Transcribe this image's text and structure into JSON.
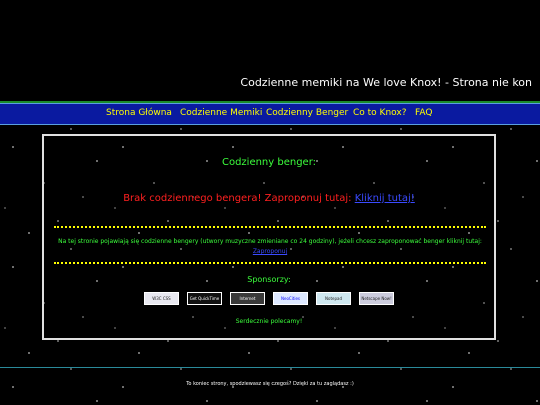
{
  "site": {
    "title": "Codzienne memiki na We love Knox! - Strona nie kon"
  },
  "nav": {
    "items": [
      {
        "label": "Strona Główna"
      },
      {
        "label": "Codzienne Memiki"
      },
      {
        "label": "Codzienny Benger"
      },
      {
        "label": "Co to Knox?"
      },
      {
        "label": "FAQ"
      }
    ]
  },
  "main": {
    "heading": "Codzienny benger:",
    "no_benger_text": "Brak codziennego bengera! Zaproponuj tutaj: ",
    "no_benger_link": "Kliknij tutaj!",
    "info_text": "Na tej stronie pojawiają się codzienne bengery (utwory muzyczne zmieniane co 24 godziny), jeżeli chcesz zaproponować benger kliknij tutaj: ",
    "info_link": "Zaproponuj",
    "sponsors_label": "Sponsorzy:",
    "badges": [
      {
        "name": "W3C CSS"
      },
      {
        "name": "Get QuickTime"
      },
      {
        "name": "Internet Explorer"
      },
      {
        "name": "NeoCities"
      },
      {
        "name": "Notepad"
      },
      {
        "name": "Netscape Now!"
      }
    ],
    "thanks": "Serdecznie polecamy!"
  },
  "footer": {
    "text": "To koniec strony, spodziewasz się czegoś? Dzięki za tu zaglądasz :)"
  },
  "colors": {
    "nav_bg": "#0a1aa0",
    "nav_text": "#ffff00",
    "heading_green": "#3cff3c",
    "alert_red": "#ff2020",
    "link_blue": "#3a4aff"
  }
}
